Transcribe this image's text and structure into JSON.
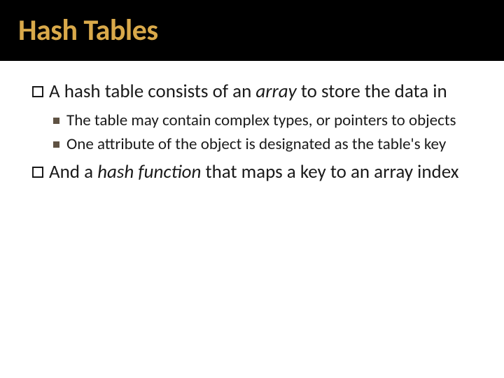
{
  "title": "Hash Tables",
  "b1": {
    "pre": "A hash table consists of an ",
    "em": "array",
    "post": " to store the data in"
  },
  "s1": "The table may contain complex types, or pointers to objects",
  "s2": "One attribute of the object is designated as the table's key",
  "b2": {
    "pre": "And a ",
    "em": "hash function",
    "post": " that maps a key to an array index"
  }
}
